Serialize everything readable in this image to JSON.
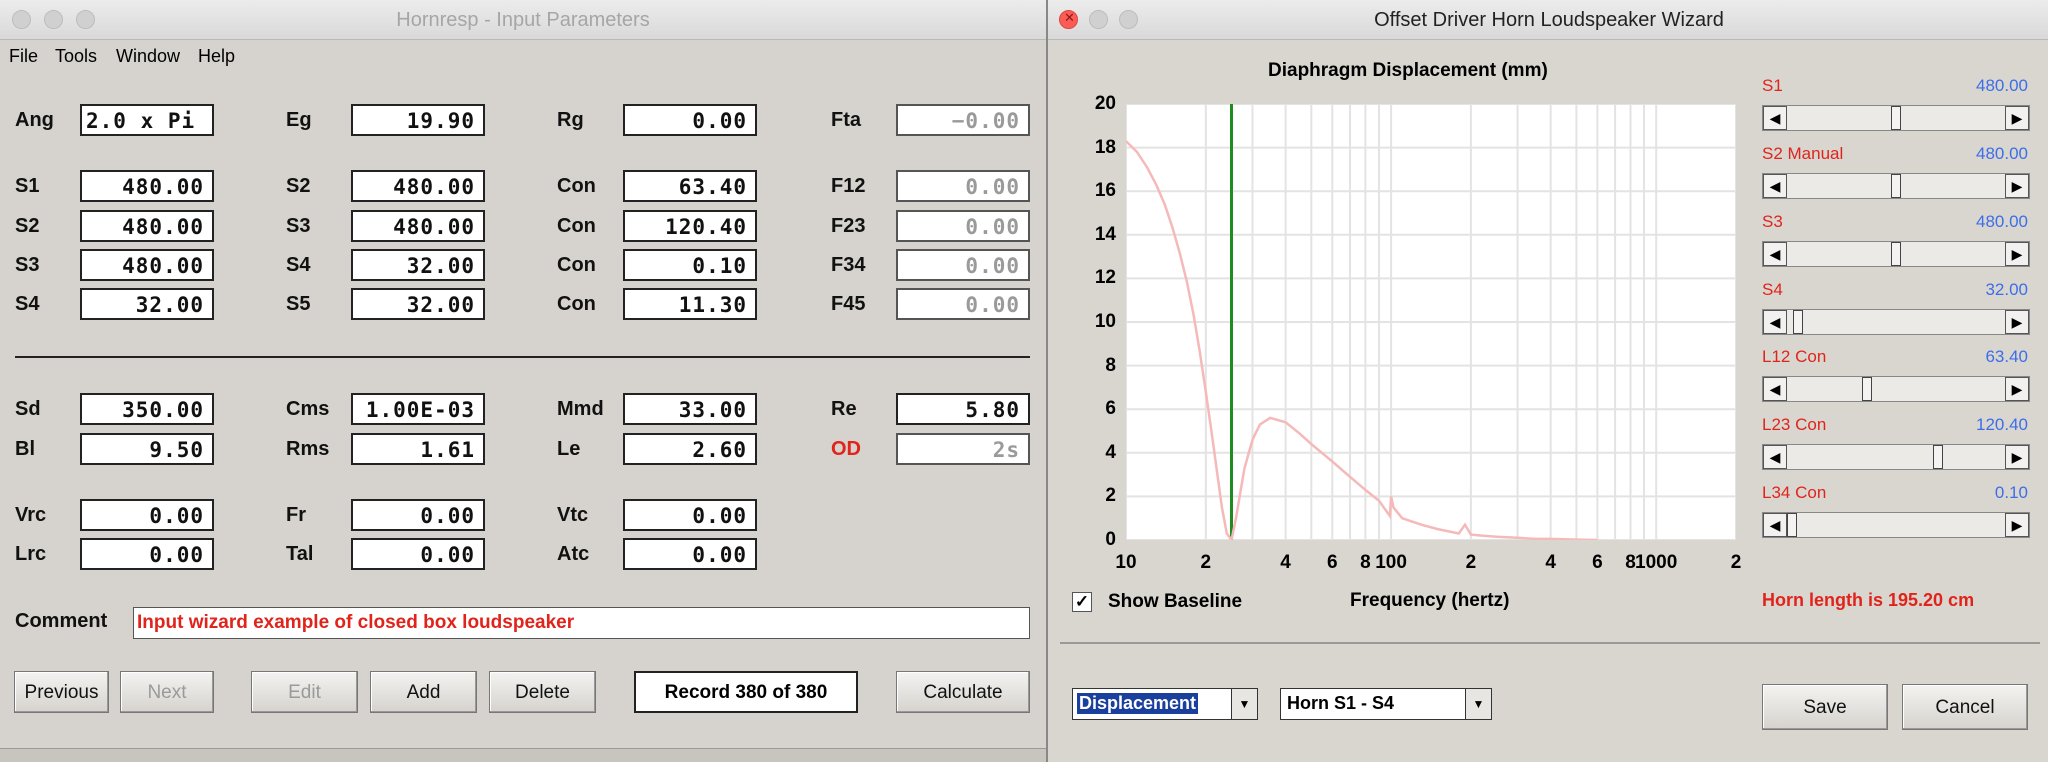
{
  "left_window": {
    "title": "Hornresp - Input Parameters",
    "menu": [
      "File",
      "Tools",
      "Window",
      "Help"
    ],
    "rows": [
      [
        {
          "label": "Ang",
          "value": "2.0 x Pi",
          "grey": false
        },
        {
          "label": "Eg",
          "value": "19.90",
          "grey": false
        },
        {
          "label": "Rg",
          "value": "0.00",
          "grey": false
        },
        {
          "label": "Fta",
          "value": "−0.00",
          "grey": true
        }
      ],
      [
        {
          "label": "S1",
          "value": "480.00",
          "grey": false
        },
        {
          "label": "S2",
          "value": "480.00",
          "grey": false
        },
        {
          "label": "Con",
          "value": "63.40",
          "grey": false
        },
        {
          "label": "F12",
          "value": "0.00",
          "grey": true
        }
      ],
      [
        {
          "label": "S2",
          "value": "480.00",
          "grey": false
        },
        {
          "label": "S3",
          "value": "480.00",
          "grey": false
        },
        {
          "label": "Con",
          "value": "120.40",
          "grey": false
        },
        {
          "label": "F23",
          "value": "0.00",
          "grey": true
        }
      ],
      [
        {
          "label": "S3",
          "value": "480.00",
          "grey": false
        },
        {
          "label": "S4",
          "value": "32.00",
          "grey": false
        },
        {
          "label": "Con",
          "value": "0.10",
          "grey": false
        },
        {
          "label": "F34",
          "value": "0.00",
          "grey": true
        }
      ],
      [
        {
          "label": "S4",
          "value": "32.00",
          "grey": false
        },
        {
          "label": "S5",
          "value": "32.00",
          "grey": false
        },
        {
          "label": "Con",
          "value": "11.30",
          "grey": false
        },
        {
          "label": "F45",
          "value": "0.00",
          "grey": true
        }
      ],
      [
        {
          "label": "Sd",
          "value": "350.00",
          "grey": false
        },
        {
          "label": "Cms",
          "value": "1.00E-03",
          "grey": false
        },
        {
          "label": "Mmd",
          "value": "33.00",
          "grey": false
        },
        {
          "label": "Re",
          "value": "5.80",
          "grey": false
        }
      ],
      [
        {
          "label": "Bl",
          "value": "9.50",
          "grey": false
        },
        {
          "label": "Rms",
          "value": "1.61",
          "grey": false
        },
        {
          "label": "Le",
          "value": "2.60",
          "grey": false
        },
        {
          "label": "OD",
          "value": "2s",
          "grey": true,
          "red_label": true
        }
      ],
      [
        {
          "label": "Vrc",
          "value": "0.00",
          "grey": false
        },
        {
          "label": "Fr",
          "value": "0.00",
          "grey": false
        },
        {
          "label": "Vtc",
          "value": "0.00",
          "grey": false
        }
      ],
      [
        {
          "label": "Lrc",
          "value": "0.00",
          "grey": false
        },
        {
          "label": "Tal",
          "value": "0.00",
          "grey": false
        },
        {
          "label": "Atc",
          "value": "0.00",
          "grey": false
        }
      ]
    ],
    "comment_label": "Comment",
    "comment": "Input wizard example of closed box loudspeaker",
    "buttons": {
      "previous": "Previous",
      "next": "Next",
      "edit": "Edit",
      "add": "Add",
      "delete": "Delete",
      "calculate": "Calculate"
    },
    "record": "Record 380 of 380"
  },
  "right_window": {
    "title": "Offset Driver Horn Loudspeaker Wizard",
    "show_baseline": "Show Baseline",
    "show_baseline_checked": true,
    "horn_length": "Horn length is 195.20 cm",
    "sliders": [
      {
        "label": "S1",
        "value": "480.00",
        "fraction": 0.5
      },
      {
        "label": "S2  Manual",
        "value": "480.00",
        "fraction": 0.5
      },
      {
        "label": "S3",
        "value": "480.00",
        "fraction": 0.5
      },
      {
        "label": "S4",
        "value": "32.00",
        "fraction": 0.03
      },
      {
        "label": "L12  Con",
        "value": "63.40",
        "fraction": 0.36
      },
      {
        "label": "L23  Con",
        "value": "120.40",
        "fraction": 0.7
      },
      {
        "label": "L34  Con",
        "value": "0.10",
        "fraction": 0.0
      }
    ],
    "combo_type": "Displacement",
    "combo_horn": "Horn S1 - S4",
    "save": "Save",
    "cancel": "Cancel",
    "colors": {
      "curve": "#f5b9b9",
      "marker": "#1e8c1e",
      "red_text": "#e0241c",
      "blue_text": "#3d6ee8"
    }
  },
  "chart_data": {
    "type": "line",
    "title": "Diaphragm Displacement (mm)",
    "xlabel": "Frequency (hertz)",
    "ylabel": "",
    "x_scale": "log",
    "xlim": [
      10,
      2000
    ],
    "ylim": [
      0,
      20
    ],
    "x_ticks": [
      "10",
      "2",
      "4",
      "6",
      "8",
      "100",
      "2",
      "4",
      "6",
      "8",
      "1000",
      "2"
    ],
    "y_ticks": [
      "0",
      "2",
      "4",
      "6",
      "8",
      "10",
      "12",
      "14",
      "16",
      "18",
      "20"
    ],
    "marker_frequency": 25,
    "series": [
      {
        "x": [
          10,
          11,
          12,
          13,
          14,
          15,
          16,
          17,
          18,
          19,
          20,
          21,
          22,
          23,
          24,
          25,
          26,
          27,
          28,
          30,
          32,
          35,
          40,
          45,
          50,
          60,
          70,
          80,
          90,
          99,
          100,
          102,
          110,
          130,
          150,
          180,
          190,
          200,
          220,
          250,
          300,
          350,
          400,
          500,
          600
        ],
        "y": [
          18.3,
          17.8,
          17.1,
          16.3,
          15.4,
          14.3,
          13.1,
          11.8,
          10.3,
          8.6,
          6.8,
          5.0,
          3.2,
          1.5,
          0.3,
          0.0,
          1.0,
          2.2,
          3.3,
          4.6,
          5.3,
          5.6,
          5.4,
          4.9,
          4.4,
          3.6,
          2.9,
          2.3,
          1.8,
          1.1,
          2.0,
          1.5,
          1.0,
          0.7,
          0.5,
          0.3,
          0.7,
          0.25,
          0.2,
          0.15,
          0.1,
          0.05,
          0.05,
          0.02,
          0.0
        ]
      }
    ]
  }
}
